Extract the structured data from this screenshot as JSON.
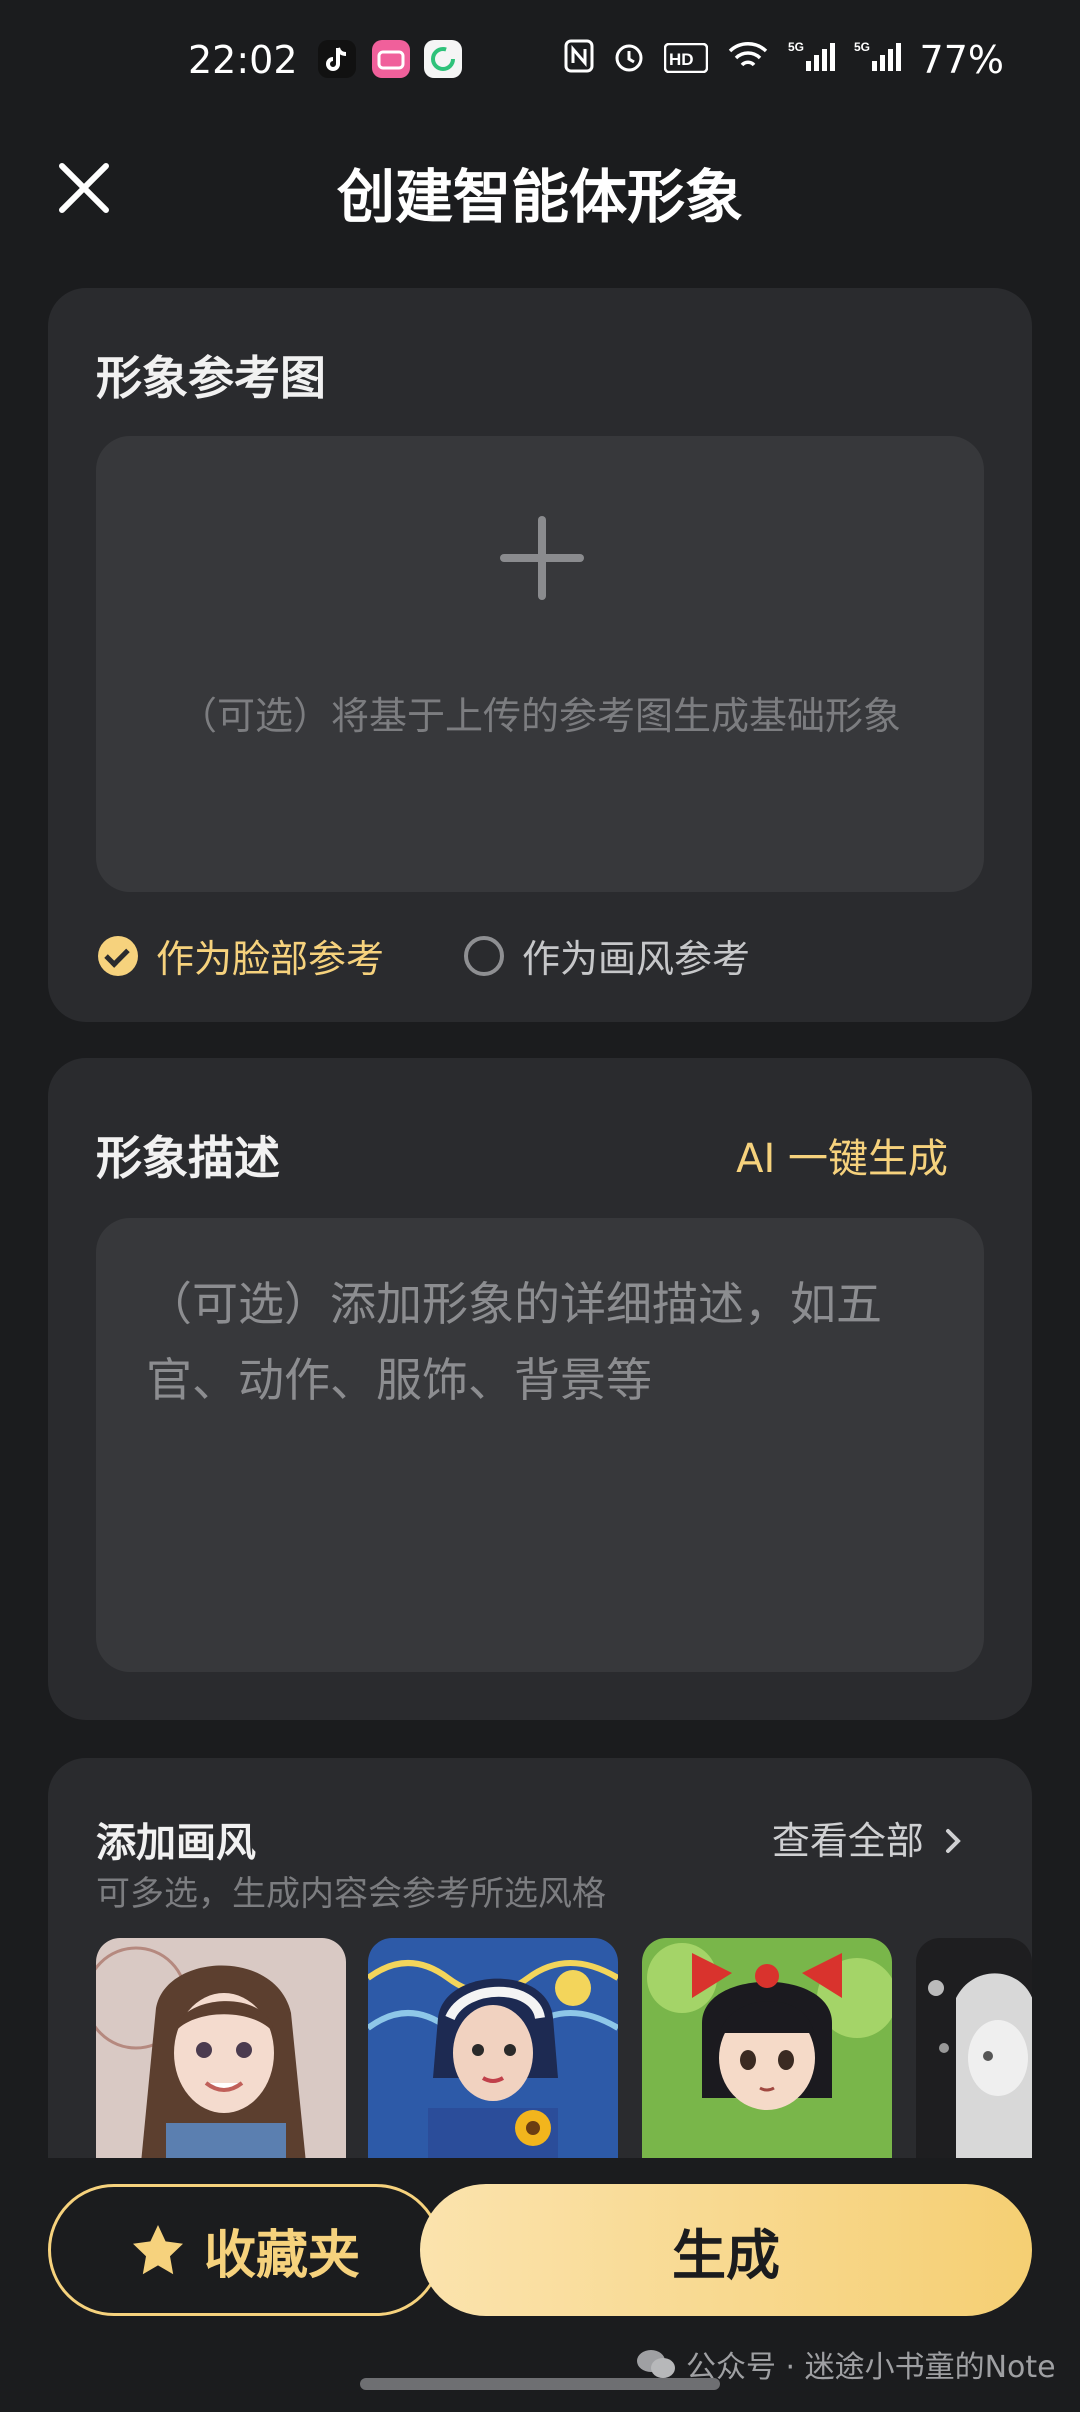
{
  "status_bar": {
    "time": "22:02",
    "battery": "77%"
  },
  "header": {
    "title": "创建智能体形象"
  },
  "reference_card": {
    "label": "形象参考图",
    "upload_hint": "（可选）将基于上传的参考图生成基础形象",
    "option_face": "作为脸部参考",
    "option_style": "作为画风参考",
    "selected": "face"
  },
  "description_card": {
    "label": "形象描述",
    "ai_generate": "AI 一键生成",
    "placeholder": "（可选）添加形象的详细描述，如五官、动作、服饰、背景等"
  },
  "style_card": {
    "label": "添加画风",
    "view_all": "查看全部",
    "subtitle": "可多选，生成内容会参考所选风格"
  },
  "bottom": {
    "favorites_label": "收藏夹",
    "generate_label": "生成"
  },
  "watermark": "公众号 · 迷途小书童的Note",
  "colors": {
    "accent": "#f6d27d",
    "background": "#1b1c1e",
    "card": "#2a2b2e"
  }
}
